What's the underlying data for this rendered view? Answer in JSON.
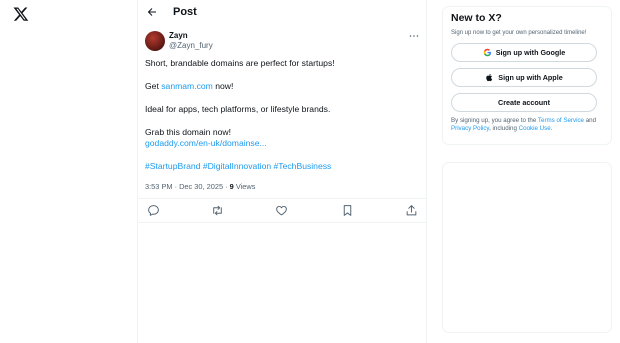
{
  "page": {
    "header_title": "Post"
  },
  "post": {
    "display_name": "Zayn",
    "handle": "@Zayn_fury",
    "line1": "Short, brandable domains are perfect for startups!",
    "line2_prefix": "Get ",
    "line2_link": "sanmam.com",
    "line2_suffix": " now!",
    "line3": "Ideal for apps, tech platforms, or lifestyle brands.",
    "line4": "Grab this domain now!",
    "line5_link": "godaddy.com/en-uk/domainse...",
    "hashtags": [
      "#StartupBrand",
      "#DigitalInnovation",
      "#TechBusiness"
    ],
    "timestamp": "3:53 PM · Dec 30, 2025",
    "views_separator": " · ",
    "views_count": "9",
    "views_label": " Views"
  },
  "actions": {
    "icons": [
      "reply-icon",
      "repost-icon",
      "like-icon",
      "bookmark-icon",
      "share-icon"
    ]
  },
  "signup_card": {
    "title": "New to X?",
    "subtitle": "Sign up now to get your own personalized timeline!",
    "google_label": "Sign up with Google",
    "apple_label": "Sign up with Apple",
    "create_label": "Create account",
    "legal_prefix": "By signing up, you agree to the ",
    "terms_link": "Terms of Service",
    "legal_and": " and",
    "privacy_link": "Privacy Policy",
    "legal_including": ", including ",
    "cookie_link": "Cookie Use",
    "legal_end": "."
  },
  "colors": {
    "link": "#1d9bf0",
    "text": "#0f1419",
    "muted": "#536471",
    "border": "#eff3f4"
  }
}
